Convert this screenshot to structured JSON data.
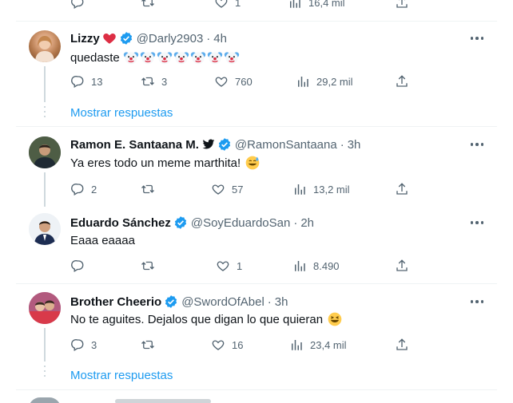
{
  "top_actions": {
    "replies": "",
    "retweets": "",
    "likes": "1",
    "views": "16,4 mil"
  },
  "tweets": [
    {
      "name": "Lizzy",
      "handle": "@Darly2903",
      "sep": "·",
      "time": "4h",
      "text": "quedaste",
      "emoji_count": 7,
      "replies": "13",
      "retweets": "3",
      "likes": "760",
      "views": "29,2 mil",
      "show_more": "Mostrar respuestas"
    },
    {
      "name": "Ramon E. Santaana M.",
      "handle": "@RamonSantaana",
      "sep": "·",
      "time": "3h",
      "text": "Ya eres todo un meme marthita!",
      "replies": "2",
      "retweets": "",
      "likes": "57",
      "views": "13,2 mil"
    },
    {
      "name": "Eduardo Sánchez",
      "handle": "@SoyEduardoSan",
      "sep": "·",
      "time": "2h",
      "text": "Eaaa eaaaa",
      "replies": "",
      "retweets": "",
      "likes": "1",
      "views": "8.490"
    },
    {
      "name": "Brother Cheerio",
      "handle": "@SwordOfAbel",
      "sep": "·",
      "time": "3h",
      "text": "No te aguites. Dejalos que digan lo que quieran",
      "replies": "3",
      "retweets": "",
      "likes": "16",
      "views": "23,4 mil",
      "show_more": "Mostrar respuestas"
    }
  ],
  "colors": {
    "accent": "#1d9bf0",
    "muted": "#536471",
    "verified": "#1d9bf0",
    "divider": "#eff3f4"
  },
  "icons": [
    "reply-icon",
    "retweet-icon",
    "like-icon",
    "views-icon",
    "share-icon",
    "verified-icon",
    "more-icon"
  ]
}
